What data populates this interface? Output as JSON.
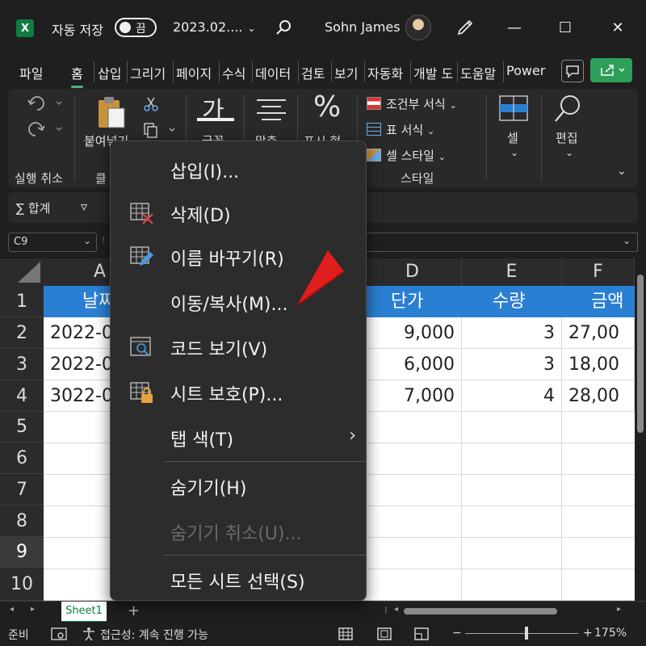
{
  "titlebar": {
    "logo": "X",
    "autosave_label": "자동 저장",
    "autosave_state": "끔",
    "filename": "2023.02....",
    "username": "Sohn James",
    "minimize": "—",
    "maximize": "☐",
    "close": "✕"
  },
  "tabs": [
    "파일",
    "홈",
    "삽입",
    "그리기",
    "페이지",
    "수식",
    "데이터",
    "검토",
    "보기",
    "자동화",
    "개발 도",
    "도움말",
    "Power"
  ],
  "ribbon": {
    "undo_label": "실행 취소",
    "paste_label": "붙여넣기",
    "clipboard_label": "클",
    "font_label": "글꼴",
    "align_label": "맞춤",
    "number_label": "표시 형",
    "conditional_format": "조건부 서식",
    "table_format": "표 서식",
    "cell_style": "셀 스타일",
    "styles_label": "스타일",
    "cells_label": "셀",
    "edit_label": "편집",
    "font_glyph": "가",
    "number_glyph": "%"
  },
  "subbar": {
    "sum_label": "∑ 합계",
    "filter_glyph": "▿"
  },
  "namebox": {
    "value": "C9"
  },
  "grid": {
    "columns": [
      "A",
      "D",
      "E",
      "F"
    ],
    "rows": [
      "1",
      "2",
      "3",
      "4",
      "5",
      "6",
      "7",
      "8",
      "9",
      "10"
    ],
    "header_row": [
      "날짜",
      "단가",
      "수량",
      "금액"
    ],
    "data": [
      [
        "2022-0",
        "9,000",
        "3",
        "27,00"
      ],
      [
        "2022-0",
        "6,000",
        "3",
        "18,00"
      ],
      [
        "3022-0",
        "7,000",
        "4",
        "28,00"
      ]
    ],
    "header_color": "#2b7fd3"
  },
  "sheets": {
    "active": "Sheet1",
    "add": "+"
  },
  "status": {
    "ready": "준비",
    "accessibility": "접근성: 계속 진행 가능",
    "zoom": "175%",
    "zoom_minus": "−",
    "zoom_plus": "+"
  },
  "context_menu": {
    "items": [
      {
        "label": "삽입(I)...",
        "icon": "none"
      },
      {
        "label": "삭제(D)",
        "icon": "delete-sheet-icon"
      },
      {
        "label": "이름 바꾸기(R)",
        "icon": "rename-sheet-icon"
      },
      {
        "label": "이동/복사(M)...",
        "icon": "none"
      },
      {
        "label": "코드 보기(V)",
        "icon": "view-code-icon"
      },
      {
        "label": "시트 보호(P)...",
        "icon": "protect-sheet-icon"
      },
      {
        "label": "탭 색(T)",
        "icon": "none",
        "submenu": "›"
      },
      {
        "label": "숨기기(H)",
        "icon": "none"
      },
      {
        "label": "숨기기 취소(U)...",
        "icon": "none",
        "disabled": true
      },
      {
        "label": "모든 시트 선택(S)",
        "icon": "none"
      }
    ]
  },
  "colors": {
    "accent_green": "#107c41",
    "annotation_red": "#e01e1e"
  }
}
